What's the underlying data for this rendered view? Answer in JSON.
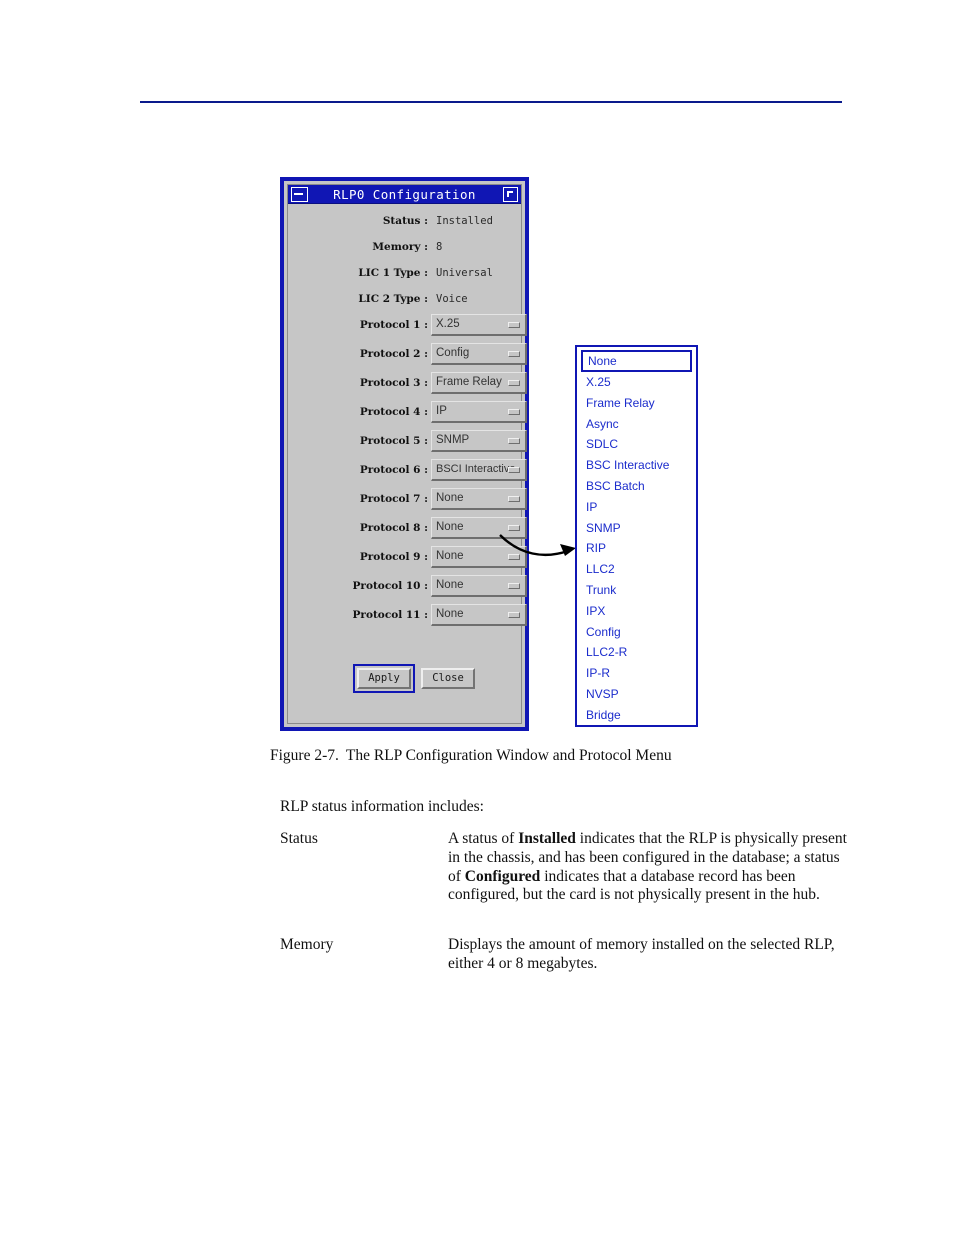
{
  "window": {
    "title": "RLP0 Configuration",
    "titlebar_left_icon": "minimize-icon",
    "titlebar_right_icon": "maximize-icon",
    "fields": [
      {
        "label": "Status :",
        "value": "Installed",
        "type": "static"
      },
      {
        "label": "Memory :",
        "value": "8",
        "type": "static"
      },
      {
        "label": "LIC 1 Type :",
        "value": "Universal",
        "type": "static"
      },
      {
        "label": "LIC 2 Type :",
        "value": "Voice",
        "type": "static"
      },
      {
        "label": "Protocol 1 :",
        "value": "X.25",
        "type": "optionmenu"
      },
      {
        "label": "Protocol 2 :",
        "value": "Config",
        "type": "optionmenu"
      },
      {
        "label": "Protocol 3 :",
        "value": "Frame Relay",
        "type": "optionmenu"
      },
      {
        "label": "Protocol 4 :",
        "value": "IP",
        "type": "optionmenu"
      },
      {
        "label": "Protocol 5 :",
        "value": "SNMP",
        "type": "optionmenu"
      },
      {
        "label": "Protocol 6 :",
        "value": "BSCI Interactive",
        "type": "optionmenu"
      },
      {
        "label": "Protocol 7 :",
        "value": "None",
        "type": "optionmenu"
      },
      {
        "label": "Protocol 8 :",
        "value": "None",
        "type": "optionmenu"
      },
      {
        "label": "Protocol 9 :",
        "value": "None",
        "type": "optionmenu"
      },
      {
        "label": "Protocol 10 :",
        "value": "None",
        "type": "optionmenu"
      },
      {
        "label": "Protocol 11 :",
        "value": "None",
        "type": "optionmenu"
      }
    ],
    "buttons": {
      "apply_label": "Apply",
      "close_label": "Close"
    }
  },
  "protocol_menu": {
    "selected": "None",
    "items": [
      "None",
      "X.25",
      "Frame Relay",
      "Async",
      "SDLC",
      "BSC Interactive",
      "BSC Batch",
      "IP",
      "SNMP",
      "RIP",
      "LLC2",
      "Trunk",
      "IPX",
      "Config",
      "LLC2-R",
      "IP-R",
      "NVSP",
      "Bridge"
    ]
  },
  "caption": {
    "number": "Figure 2-7.",
    "text": "The RLP Configuration Window and Protocol Menu"
  },
  "body": {
    "intro": "RLP status information includes:",
    "definitions": [
      {
        "term": "Status",
        "desc_part1": "A status of ",
        "desc_bold1": "Installed",
        "desc_part2": " indicates that the RLP is physically present in the chassis, and has been configured in the database; a status of ",
        "desc_bold2": "Configured",
        "desc_part3": " indicates that a database record has been configured, but the card is not physically present in the hub."
      },
      {
        "term": "Memory",
        "desc_part1": "Displays the amount of memory installed on the selected RLP, either 4 or 8 megabytes.",
        "desc_bold1": "",
        "desc_part2": "",
        "desc_bold2": "",
        "desc_part3": ""
      }
    ]
  },
  "colors": {
    "accent_blue": "#1016b4",
    "menu_text": "#1b2ccc",
    "window_bg": "#c6c6c6",
    "rule": "#0a1a8c"
  }
}
